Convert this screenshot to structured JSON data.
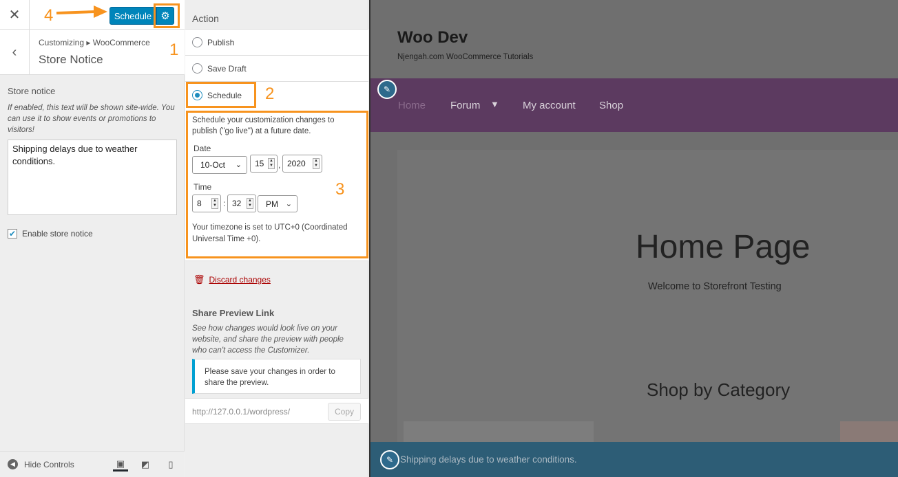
{
  "header": {
    "close_label": "✕",
    "schedule_button": "Schedule",
    "annotation_4": "4"
  },
  "section": {
    "breadcrumb": "Customizing ▸ WooCommerce",
    "title": "Store Notice",
    "annotation_1": "1"
  },
  "store_notice": {
    "label": "Store notice",
    "description": "If enabled, this text will be shown site-wide. You can use it to show events or promotions to visitors!",
    "value": "Shipping delays due to weather conditions.",
    "enable_label": "Enable store notice",
    "enabled": true
  },
  "footer": {
    "hide_controls": "Hide Controls"
  },
  "publish_settings": {
    "action_heading": "Action",
    "options": [
      {
        "label": "Publish",
        "selected": false
      },
      {
        "label": "Save Draft",
        "selected": false
      },
      {
        "label": "Schedule",
        "selected": true
      }
    ],
    "annotation_2": "2",
    "annotation_3": "3",
    "schedule_description": "Schedule your customization changes to publish (\"go live\") at a future date.",
    "date_label": "Date",
    "month": "10-Oct",
    "day": "15",
    "year": "2020",
    "time_label": "Time",
    "hour": "8",
    "minute": "32",
    "ampm": "PM",
    "timezone": "Your timezone is set to UTC+0 (Coordinated Universal Time +0).",
    "discard_label": "Discard changes",
    "share_heading": "Share Preview Link",
    "share_description": "See how changes would look live on your website, and share the preview with people who can't access the Customizer.",
    "share_notice": "Please save your changes in order to share the preview.",
    "preview_url": "http://127.0.0.1/wordpress/",
    "copy_label": "Copy"
  },
  "preview": {
    "site_title": "Woo Dev",
    "tagline": "Njengah.com WooCommerce Tutorials",
    "nav": [
      "Home",
      "Forum",
      "My account",
      "Shop"
    ],
    "page_heading": "Home Page",
    "page_subtext": "Welcome to Storefront Testing",
    "category_heading": "Shop by Category",
    "notice_text": "Shipping delays due to weather conditions."
  },
  "colors": {
    "accent": "#0085ba",
    "annotation": "#f7931e",
    "nav_bg": "#5c3a60",
    "notice_bg": "#2d5d76"
  },
  "icons": [
    "close-icon",
    "gear-icon",
    "back-chevron-icon",
    "checkmark-icon",
    "hide-controls-icon",
    "desktop-icon",
    "tablet-icon",
    "mobile-icon",
    "trash-icon",
    "pencil-icon",
    "chevron-down-icon"
  ]
}
